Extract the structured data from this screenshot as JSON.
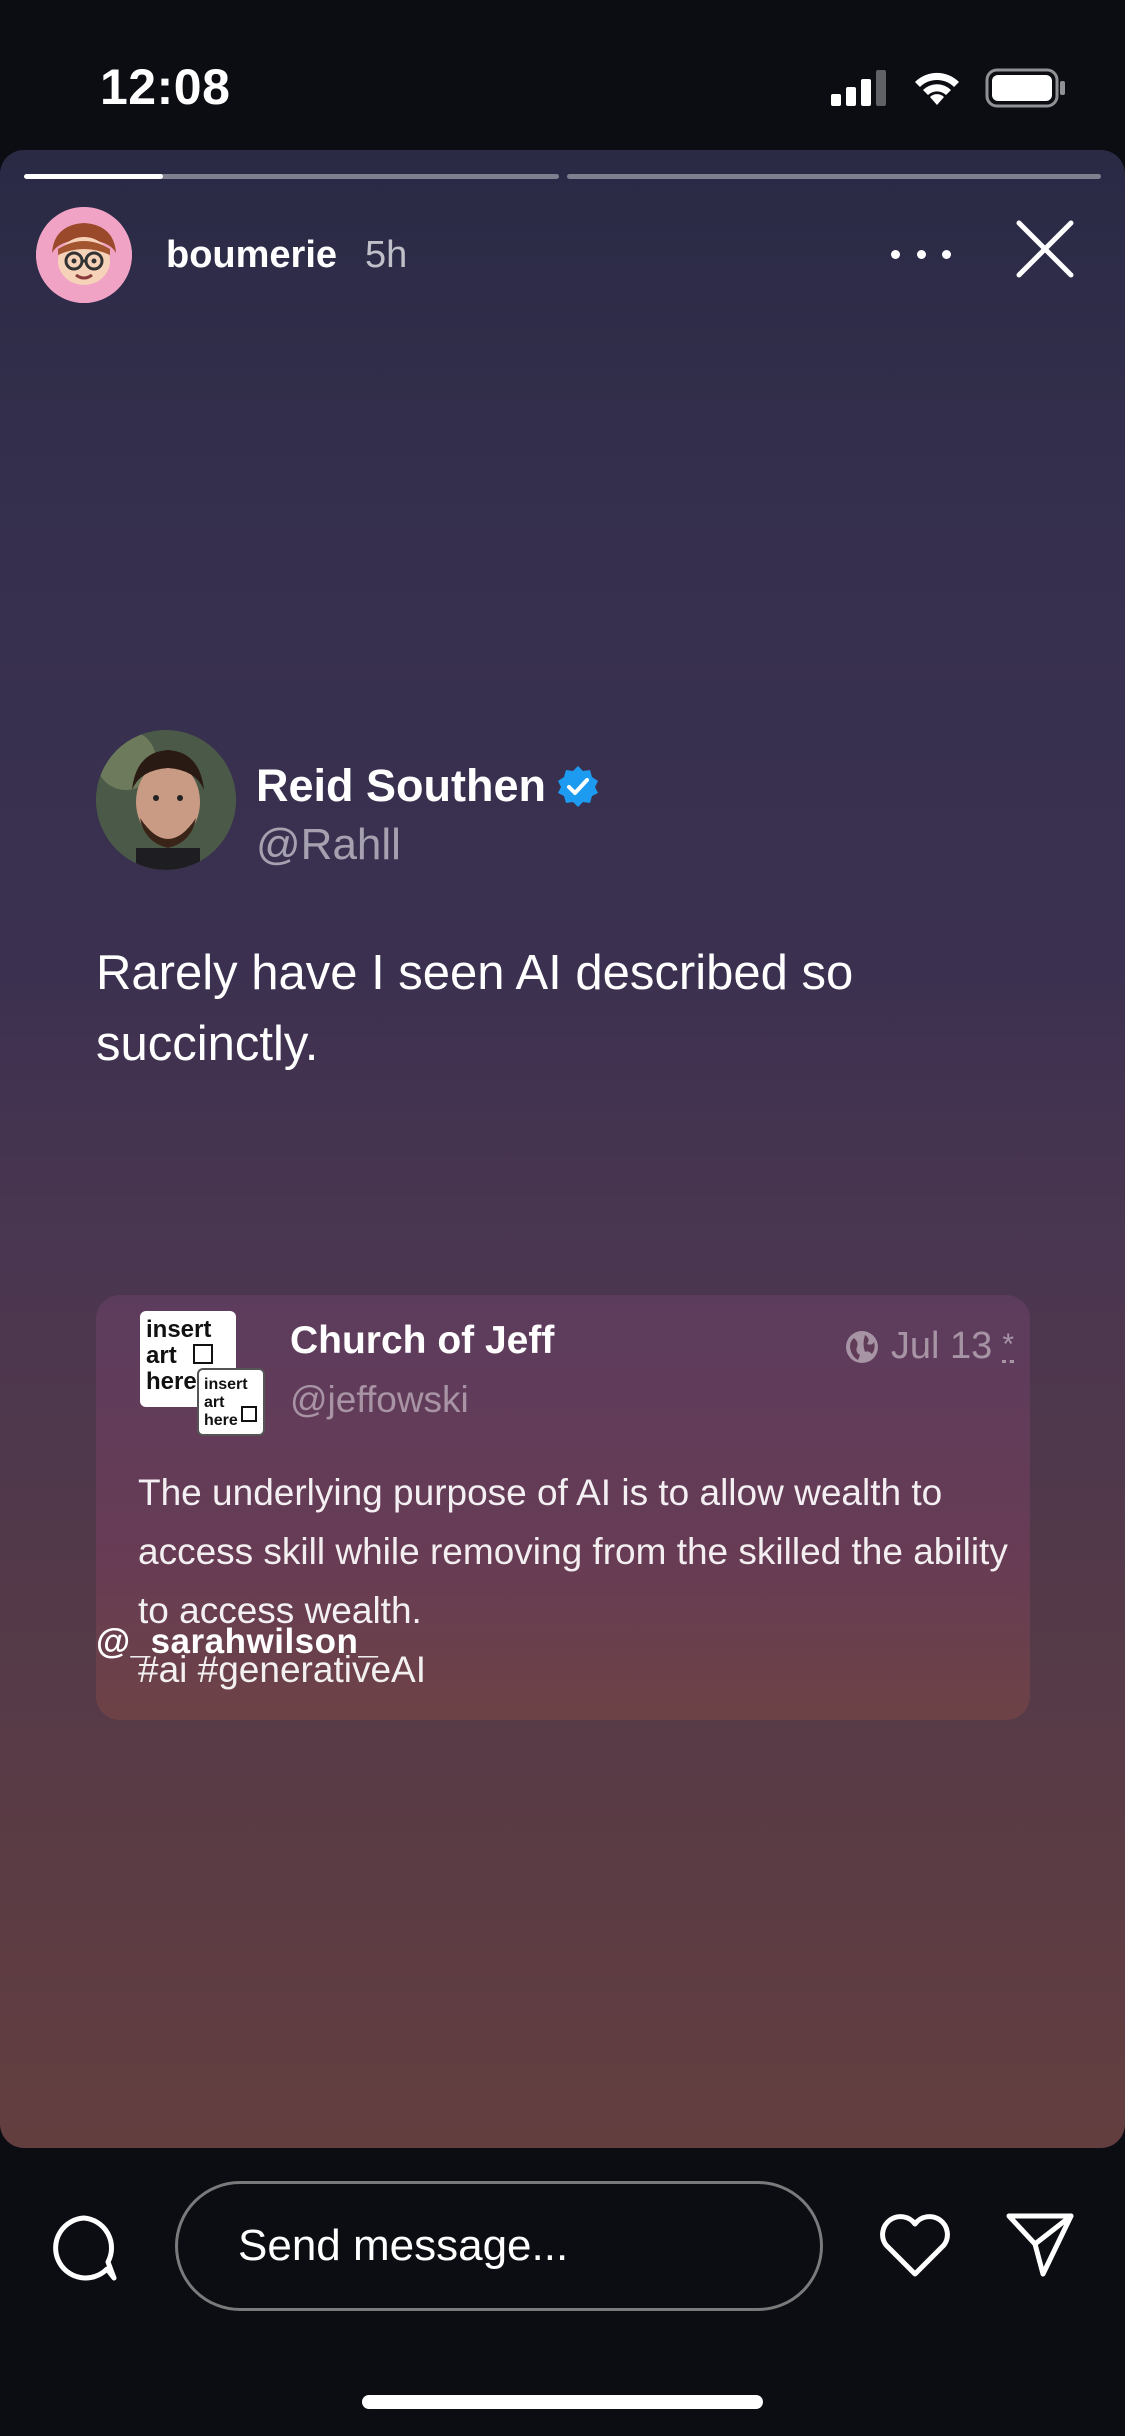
{
  "status_bar": {
    "time": "12:08",
    "icons": [
      "cellular-signal-icon",
      "wifi-icon",
      "battery-icon"
    ]
  },
  "story": {
    "progress_segments": [
      {
        "state": "active",
        "fill_fraction": 0.26
      },
      {
        "state": "upcoming",
        "fill_fraction": 0
      }
    ],
    "username": "boumerie",
    "time_ago": "5h",
    "avatar_color": "#f1a3c6",
    "icons": [
      "more-options-icon",
      "close-icon"
    ]
  },
  "tweet": {
    "author_name": "Reid Southen",
    "verified": true,
    "verified_color": "#1d9bf0",
    "handle": "@Rahll",
    "text": "Rarely have I seen AI described so succinctly.",
    "quote": {
      "author_name": "Church of Jeff",
      "handle": "@jeffowski",
      "date": "Jul 13",
      "date_marker": "*",
      "logo_lines": [
        "insert",
        "art",
        "here"
      ],
      "text": "The underlying purpose of AI is to allow wealth to access skill while removing from the skilled the ability to access wealth.",
      "hashtags": "#ai #generativeAI"
    }
  },
  "mention": "@_sarahwilson_",
  "reply_bar": {
    "placeholder": "Send message...",
    "icons": [
      "comment-icon",
      "heart-icon",
      "send-icon"
    ]
  }
}
